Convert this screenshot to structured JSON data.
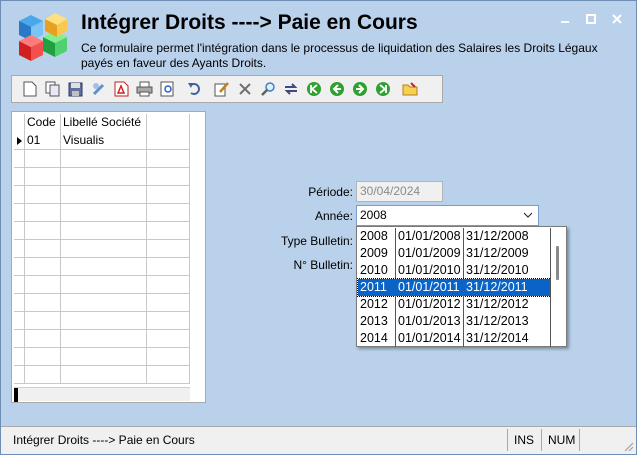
{
  "window": {
    "title": "Intégrer Droits ----> Paie en Cours",
    "description": "Ce formulaire permet l'intégration dans le processus de liquidation des Salaires les Droits Légaux payés en faveur des Ayants Droits.",
    "controls": [
      "minimize-icon",
      "maximize-icon",
      "close-icon"
    ]
  },
  "toolbar": {
    "icons": [
      "new-document-icon",
      "copy-document-icon",
      "save-icon",
      "attach-icon",
      "pdf-icon",
      "print-icon",
      "print-preview-icon",
      "undo-icon",
      "edit-icon",
      "delete-icon",
      "search-icon",
      "refresh-icon",
      "first-record-icon",
      "previous-record-icon",
      "next-record-icon",
      "last-record-icon",
      "folder-icon"
    ]
  },
  "grid": {
    "columns": [
      "Code",
      "Libellé Société",
      ""
    ],
    "rows": [
      {
        "code": "01",
        "label": "Visualis"
      }
    ]
  },
  "form": {
    "periode_label": "Période:",
    "periode_value": "30/04/2024",
    "annee_label": "Année:",
    "annee_value": "2008",
    "type_bulletin_label": "Type Bulletin:",
    "num_bulletin_label": "N° Bulletin:"
  },
  "dropdown": {
    "items": [
      {
        "year": "2008",
        "start": "01/01/2008",
        "end": "31/12/2008"
      },
      {
        "year": "2009",
        "start": "01/01/2009",
        "end": "31/12/2009"
      },
      {
        "year": "2010",
        "start": "01/01/2010",
        "end": "31/12/2010"
      },
      {
        "year": "2011",
        "start": "01/01/2011",
        "end": "31/12/2011"
      },
      {
        "year": "2012",
        "start": "01/01/2012",
        "end": "31/12/2012"
      },
      {
        "year": "2013",
        "start": "01/01/2013",
        "end": "31/12/2013"
      },
      {
        "year": "2014",
        "start": "01/01/2014",
        "end": "31/12/2014"
      }
    ],
    "selected_index": 3
  },
  "status": {
    "text": "Intégrer Droits ----> Paie en Cours",
    "ins": "INS",
    "num": "NUM"
  },
  "colors": {
    "header_bg": "#b9d1ea",
    "selection": "#0a64c8"
  }
}
